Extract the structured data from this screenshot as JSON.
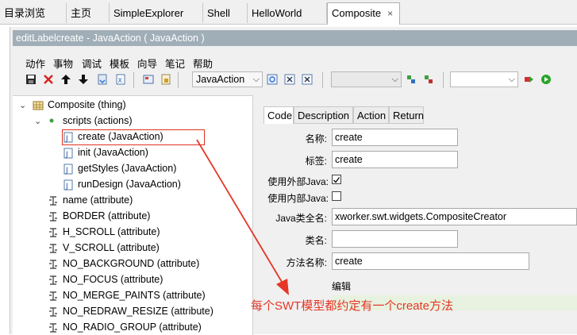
{
  "tabs": [
    {
      "label": "目录浏览"
    },
    {
      "label": "主页"
    },
    {
      "label": "SimpleExplorer"
    },
    {
      "label": "Shell"
    },
    {
      "label": "HelloWorld"
    },
    {
      "label": "Composite",
      "close": "×"
    }
  ],
  "editor": {
    "title": "editLabelcreate - JavaAction ( JavaAction )"
  },
  "menu": [
    "动作",
    "事物",
    "调试",
    "模板",
    "向导",
    "笔记",
    "帮助"
  ],
  "toolbar": {
    "type_combo": "JavaAction",
    "combo2": "",
    "combo3": ""
  },
  "tree": [
    {
      "label": "Composite (thing)"
    },
    {
      "label": "scripts (actions)"
    },
    {
      "label": "create (JavaAction)"
    },
    {
      "label": "init (JavaAction)"
    },
    {
      "label": "getStyles (JavaAction)"
    },
    {
      "label": "runDesign (JavaAction)"
    },
    {
      "label": "name (attribute)"
    },
    {
      "label": "BORDER (attribute)"
    },
    {
      "label": "H_SCROLL (attribute)"
    },
    {
      "label": "V_SCROLL (attribute)"
    },
    {
      "label": "NO_BACKGROUND (attribute)"
    },
    {
      "label": "NO_FOCUS (attribute)"
    },
    {
      "label": "NO_MERGE_PAINTS (attribute)"
    },
    {
      "label": "NO_REDRAW_RESIZE (attribute)"
    },
    {
      "label": "NO_RADIO_GROUP (attribute)"
    }
  ],
  "detail_tabs": [
    "Code",
    "Description",
    "Action",
    "Return"
  ],
  "form": {
    "name_label": "名称:",
    "name_value": "create",
    "tag_label": "标签:",
    "tag_value": "create",
    "use_outer_java_label": "使用外部Java:",
    "use_outer_java_checked": true,
    "use_inner_java_label": "使用内部Java:",
    "use_inner_java_checked": false,
    "java_class_label": "Java类全名:",
    "java_class_value": "xworker.swt.widgets.CompositeCreator",
    "class_label": "类名:",
    "class_value": "",
    "method_label": "方法名称:",
    "method_value": "create",
    "edit_label": "编辑"
  },
  "annotation": "每个SWT模型都约定有一个create方法",
  "colors": {
    "annotation": "#e53626",
    "titlebar": "#a0aeb8"
  }
}
